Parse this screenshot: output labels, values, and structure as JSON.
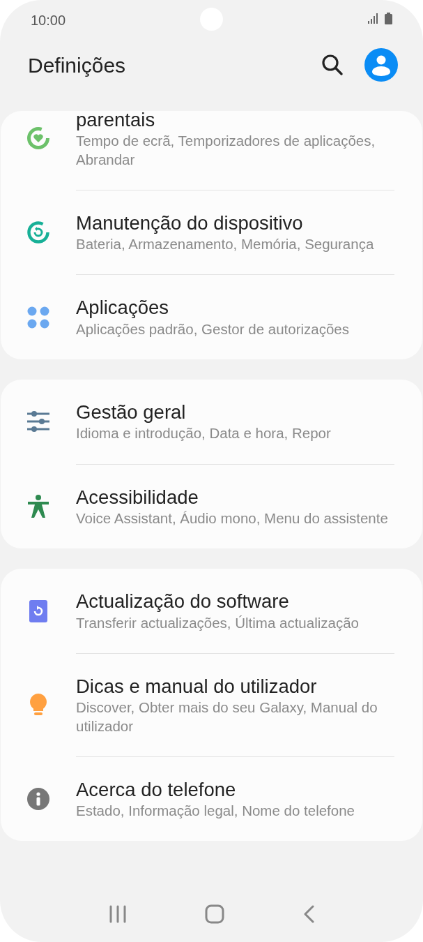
{
  "status_bar": {
    "time": "10:00"
  },
  "header": {
    "title": "Definições"
  },
  "groups": [
    {
      "items": [
        {
          "kind": "parental",
          "title": "parentais",
          "subtitle": "Tempo de ecrã, Temporizadores de aplicações, Abrandar"
        },
        {
          "kind": "maintenance",
          "title": "Manutenção do dispositivo",
          "subtitle": "Bateria, Armazenamento, Memória, Segurança"
        },
        {
          "kind": "apps",
          "title": "Aplicações",
          "subtitle": "Aplicações padrão, Gestor de autorizações"
        }
      ]
    },
    {
      "items": [
        {
          "kind": "general",
          "title": "Gestão geral",
          "subtitle": "Idioma e introdução, Data e hora, Repor"
        },
        {
          "kind": "accessibility",
          "title": "Acessibilidade",
          "subtitle": "Voice Assistant, Áudio mono, Menu do assistente"
        }
      ]
    },
    {
      "items": [
        {
          "kind": "update",
          "title": "Actualização do software",
          "subtitle": "Transferir actualizações, Última actualização"
        },
        {
          "kind": "tips",
          "title": "Dicas e manual do utilizador",
          "subtitle": "Discover, Obter mais do seu Galaxy, Manual do utilizador"
        },
        {
          "kind": "about",
          "title": "Acerca do telefone",
          "subtitle": "Estado, Informação legal, Nome do telefone"
        }
      ]
    }
  ]
}
